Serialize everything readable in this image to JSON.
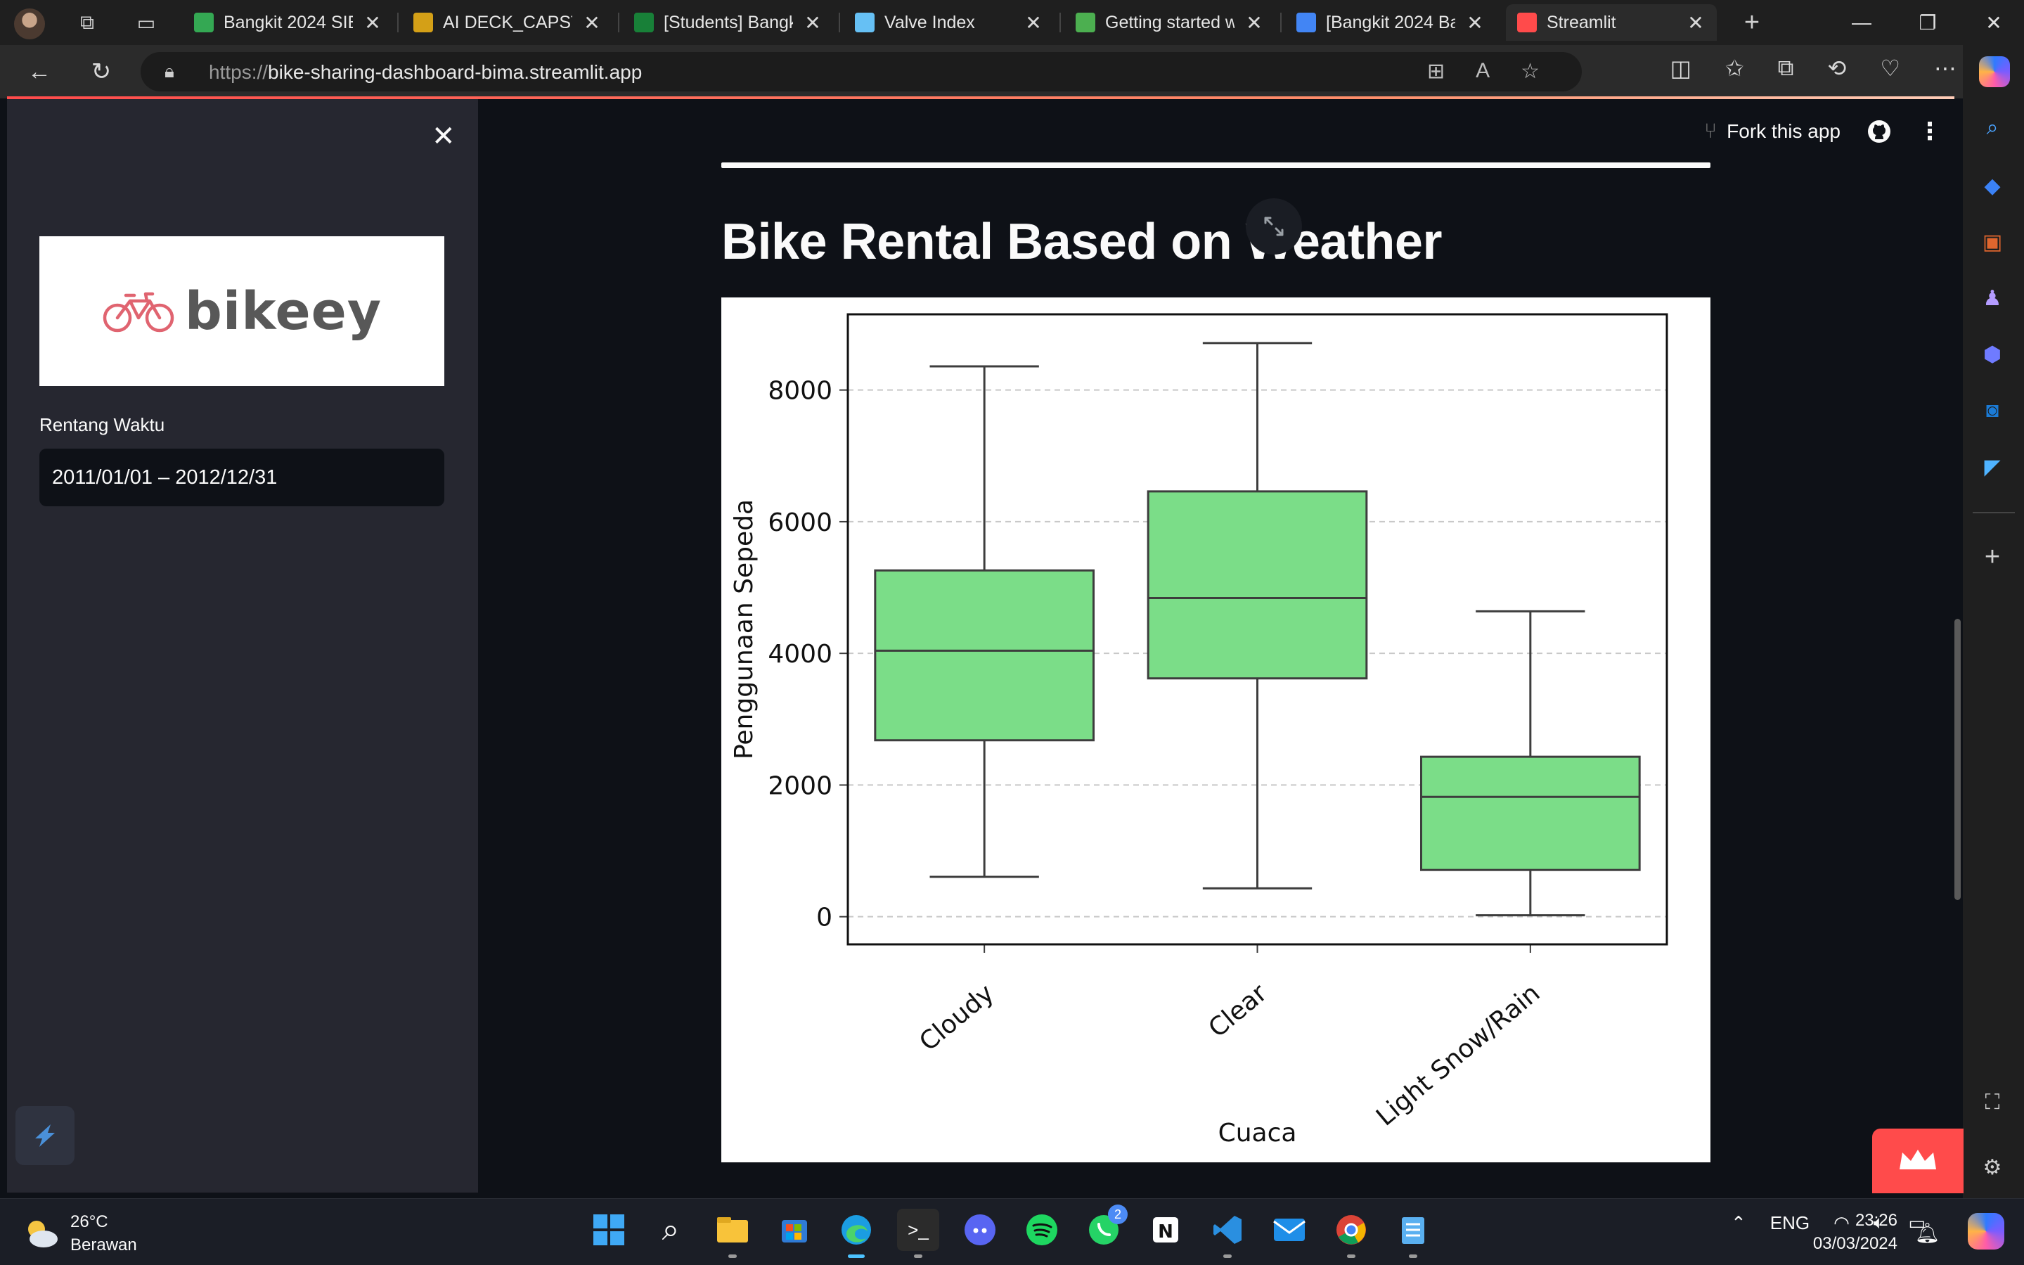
{
  "browser": {
    "tabs": [
      {
        "title": "Bangkit 2024 SIB",
        "favicon": "google-drive-icon",
        "color": "#34a853"
      },
      {
        "title": "AI DECK_CAPSTO",
        "favicon": "slides-icon",
        "color": "#d4a017"
      },
      {
        "title": "[Students] Bangk",
        "favicon": "sheets-icon",
        "color": "#188038"
      },
      {
        "title": "Valve Index",
        "favicon": "steam-icon",
        "color": "#66c0f4"
      },
      {
        "title": "Getting started w",
        "favicon": "dicoding-icon",
        "color": "#4caf50"
      },
      {
        "title": "[Bangkit 2024 Ba",
        "favicon": "docs-icon",
        "color": "#4285f4"
      },
      {
        "title": "Streamlit",
        "favicon": "streamlit-icon",
        "color": "#ff4b4b"
      }
    ],
    "url_protocol": "https://",
    "url_host": "bike-sharing-dashboard-bima.streamlit.app"
  },
  "sidebar": {
    "logo_text": "bikeey",
    "date_label": "Rentang Waktu",
    "date_range": "2011/01/01 – 2012/12/31"
  },
  "header": {
    "fork_label": "Fork this app"
  },
  "main": {
    "title": "Bike Rental Based on Weather"
  },
  "chart_data": {
    "type": "boxplot",
    "xlabel": "Cuaca",
    "ylabel": "Penggunaan Sepeda",
    "categories": [
      "Cloudy",
      "Clear",
      "Light Snow/Rain"
    ],
    "boxes": [
      {
        "category": "Cloudy",
        "whisker_low": 605,
        "q1": 2680,
        "median": 4040,
        "q3": 5260,
        "whisker_high": 8360
      },
      {
        "category": "Clear",
        "whisker_low": 431,
        "q1": 3620,
        "median": 4840,
        "q3": 6460,
        "whisker_high": 8714
      },
      {
        "category": "Light Snow/Rain",
        "whisker_low": 22,
        "q1": 710,
        "median": 1820,
        "q3": 2430,
        "whisker_high": 4639
      }
    ],
    "yticks": [
      0,
      2000,
      4000,
      6000,
      8000
    ],
    "ylim": [
      -420,
      9150
    ],
    "grid": "y-dashed",
    "box_color": "#7bdd88"
  },
  "taskbar": {
    "temperature": "26°C",
    "weather": "Berawan",
    "language": "ENG",
    "time": "23:26",
    "date": "03/03/2024",
    "whatsapp_badge": "2"
  }
}
